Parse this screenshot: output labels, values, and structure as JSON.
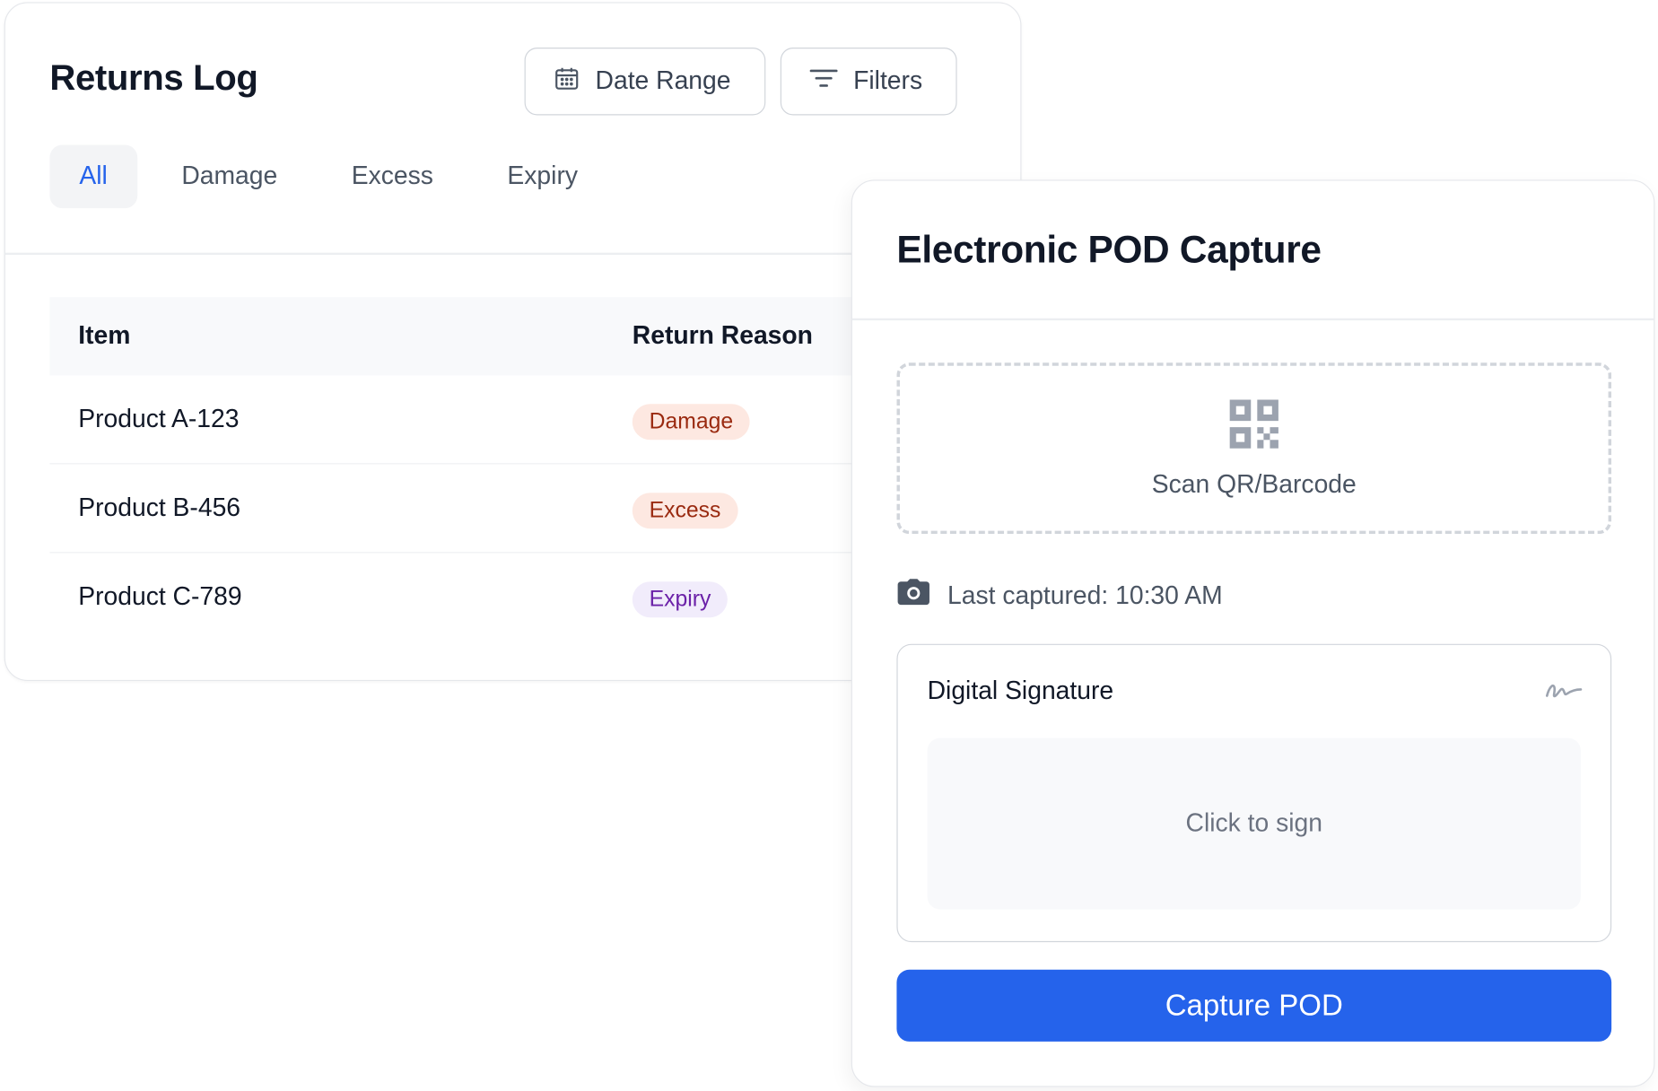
{
  "returns_log": {
    "title": "Returns Log",
    "date_range_label": "Date Range",
    "filters_label": "Filters",
    "tabs": [
      {
        "label": "All",
        "active": true
      },
      {
        "label": "Damage",
        "active": false
      },
      {
        "label": "Excess",
        "active": false
      },
      {
        "label": "Expiry",
        "active": false
      }
    ],
    "table": {
      "headers": {
        "item": "Item",
        "reason": "Return Reason"
      },
      "rows": [
        {
          "item": "Product A-123",
          "reason": "Damage",
          "badge_bg": "#fde8e1",
          "badge_fg": "#9a2a10"
        },
        {
          "item": "Product B-456",
          "reason": "Excess",
          "badge_bg": "#fde8e1",
          "badge_fg": "#9a2a10"
        },
        {
          "item": "Product C-789",
          "reason": "Expiry",
          "badge_bg": "#f1ecfb",
          "badge_fg": "#6b21a8"
        }
      ]
    }
  },
  "pod": {
    "title": "Electronic POD Capture",
    "scan_label": "Scan QR/Barcode",
    "last_captured": "Last captured: 10:30 AM",
    "signature_title": "Digital Signature",
    "signature_placeholder": "Click to sign",
    "capture_button": "Capture POD"
  },
  "colors": {
    "accent": "#2563eb",
    "text_primary": "#111827",
    "text_secondary": "#4b5563"
  },
  "icons": {
    "date_range": "calendar-icon",
    "filters": "filter-lines-icon",
    "scan": "qr-code-icon",
    "camera": "camera-icon",
    "signature": "signature-icon"
  }
}
